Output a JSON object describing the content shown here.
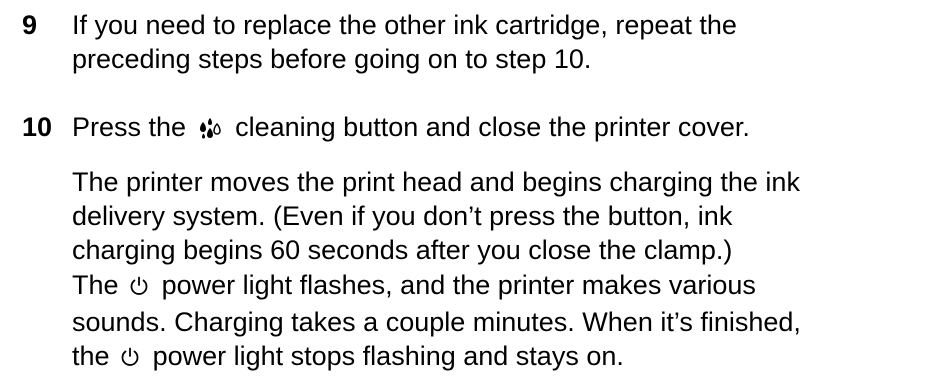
{
  "steps": [
    {
      "number": "9",
      "lines": [
        "If you need to replace the other ink cartridge, repeat the",
        "preceding steps before going on to step 10."
      ]
    },
    {
      "number": "10",
      "before_icon": "Press the",
      "after_icon": "cleaning button and close the printer cover.",
      "icon": "cleaning-icon"
    }
  ],
  "paragraphs": {
    "charging": [
      "The printer moves the print head and begins charging the ink",
      "delivery system. (Even if you don’t press the button, ink",
      "charging begins 60 seconds after you close the clamp.)"
    ],
    "power": {
      "line1_before": "The",
      "line1_after": "power light flashes, and the printer makes various",
      "line2": "sounds. Charging takes a couple minutes. When it’s finished,",
      "line3_before": "the",
      "line3_after": "power light stops flashing and stays on.",
      "icon": "power-icon"
    }
  }
}
